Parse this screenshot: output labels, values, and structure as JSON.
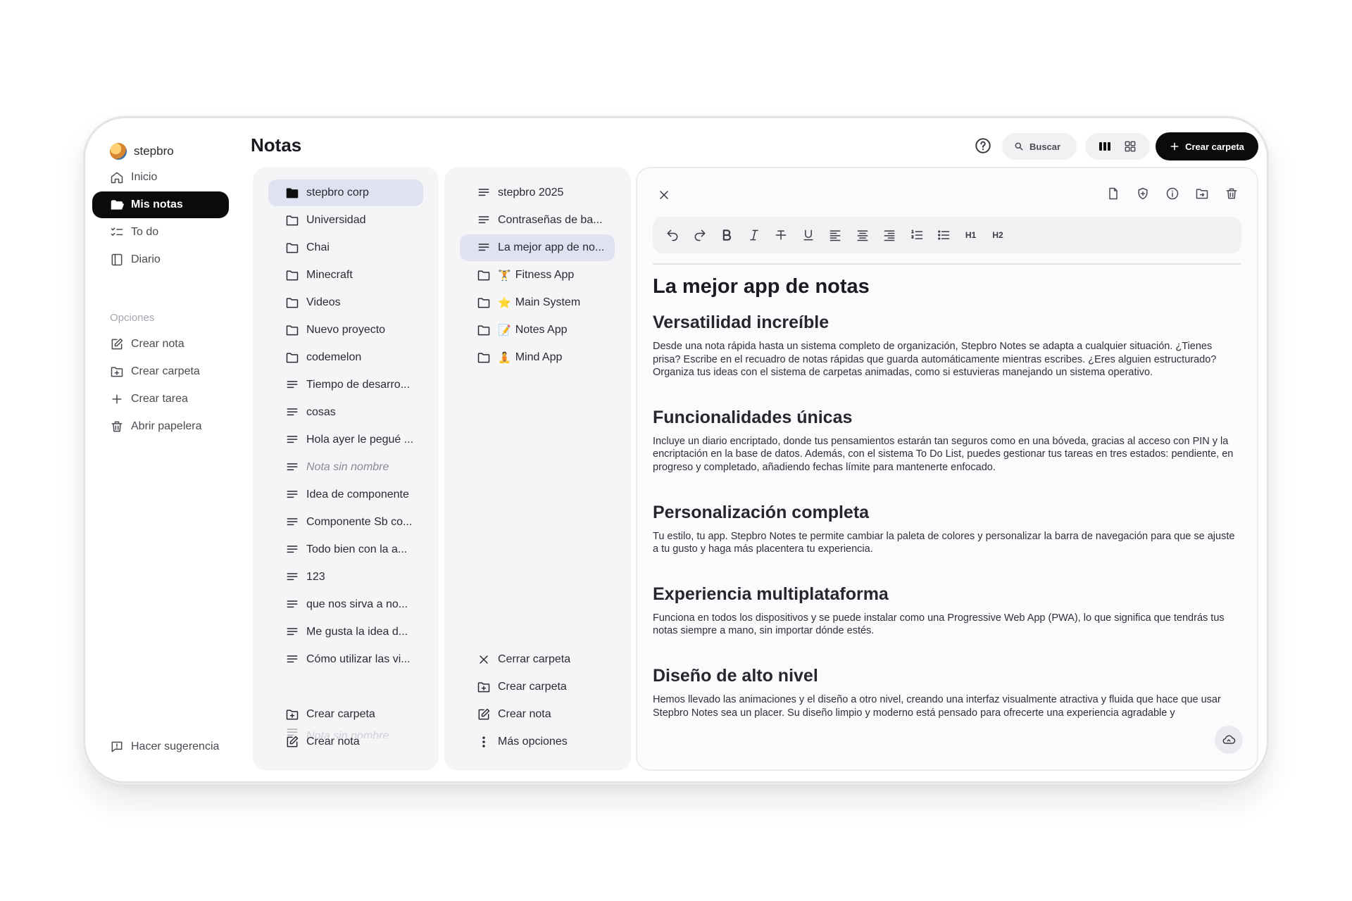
{
  "user": {
    "name": "stepbro"
  },
  "nav": {
    "inicio": "Inicio",
    "mis_notas": "Mis notas",
    "todo": "To do",
    "diario": "Diario"
  },
  "options": {
    "label": "Opciones",
    "crear_nota": "Crear nota",
    "crear_carpeta": "Crear carpeta",
    "crear_tarea": "Crear tarea",
    "abrir_papelera": "Abrir papelera"
  },
  "suggest": "Hacer sugerencia",
  "header": {
    "title": "Notas",
    "search": "Buscar",
    "create_folder": "Crear carpeta"
  },
  "col1": {
    "items": [
      {
        "label": "stepbro corp",
        "type": "folder-filled"
      },
      {
        "label": "Universidad",
        "type": "folder"
      },
      {
        "label": "Chai",
        "type": "folder"
      },
      {
        "label": "Minecraft",
        "type": "folder"
      },
      {
        "label": "Videos",
        "type": "folder"
      },
      {
        "label": "Nuevo proyecto",
        "type": "folder"
      },
      {
        "label": "codemelon",
        "type": "folder"
      },
      {
        "label": "Tiempo de desarro...",
        "type": "note"
      },
      {
        "label": "cosas",
        "type": "note"
      },
      {
        "label": "Hola ayer le pegué ...",
        "type": "note"
      },
      {
        "label": "Nota sin nombre",
        "type": "note"
      },
      {
        "label": "Idea de componente",
        "type": "note"
      },
      {
        "label": "Componente Sb co...",
        "type": "note"
      },
      {
        "label": "Todo bien con la a...",
        "type": "note"
      },
      {
        "label": "123",
        "type": "note"
      },
      {
        "label": "que nos sirva a no...",
        "type": "note"
      },
      {
        "label": "Me gusta la idea d...",
        "type": "note"
      },
      {
        "label": "Cómo utilizar las vi...",
        "type": "note"
      },
      {
        "label": "Nota sin nombre",
        "type": "note"
      }
    ],
    "crear_carpeta": "Crear carpeta",
    "crear_nota": "Crear nota"
  },
  "col2": {
    "items": [
      {
        "label": "stepbro 2025",
        "type": "note",
        "emoji": ""
      },
      {
        "label": "Contraseñas de ba...",
        "type": "note",
        "emoji": ""
      },
      {
        "label": "La mejor app de no...",
        "type": "note",
        "emoji": ""
      },
      {
        "label": "Fitness App",
        "type": "folder",
        "emoji": "🏋️"
      },
      {
        "label": "Main System",
        "type": "folder",
        "emoji": "⭐"
      },
      {
        "label": "Notes App",
        "type": "folder",
        "emoji": "📝"
      },
      {
        "label": "Mind App",
        "type": "folder",
        "emoji": "🧘"
      }
    ],
    "cerrar_carpeta": "Cerrar carpeta",
    "crear_carpeta": "Crear carpeta",
    "crear_nota": "Crear nota",
    "mas_opciones": "Más opciones"
  },
  "toolbar": {
    "h1": "H1",
    "h2": "H2"
  },
  "doc": {
    "title": "La mejor app de notas",
    "sections": [
      {
        "heading": "Versatilidad increíble",
        "body": "Desde una nota rápida hasta un sistema completo de organización, Stepbro Notes se adapta a cualquier situación. ¿Tienes prisa? Escribe en el recuadro de notas rápidas que guarda automáticamente mientras escribes. ¿Eres alguien estructurado? Organiza tus ideas con el sistema de carpetas animadas, como si estuvieras manejando un sistema operativo."
      },
      {
        "heading": "Funcionalidades únicas",
        "body": "Incluye un diario encriptado, donde tus pensamientos estarán tan seguros como en una bóveda, gracias al acceso con PIN y la encriptación en la base de datos. Además, con el sistema To Do List, puedes gestionar tus tareas en tres estados: pendiente, en progreso y completado, añadiendo fechas límite para mantenerte enfocado."
      },
      {
        "heading": "Personalización completa",
        "body": "Tu estilo, tu app. Stepbro Notes te permite cambiar la paleta de colores y personalizar la barra de navegación para que se ajuste a tu gusto y haga más placentera tu experiencia."
      },
      {
        "heading": "Experiencia multiplataforma",
        "body": "Funciona en todos los dispositivos y se puede instalar como una Progressive Web App (PWA), lo que significa que tendrás tus notas siempre a mano, sin importar dónde estés."
      },
      {
        "heading": "Diseño de alto nivel",
        "body": "Hemos llevado las animaciones y el diseño a otro nivel, creando una interfaz visualmente atractiva y fluida que hace que usar Stepbro Notes sea un placer. Su diseño limpio y moderno está pensado para ofrecerte una experiencia agradable y"
      }
    ]
  }
}
